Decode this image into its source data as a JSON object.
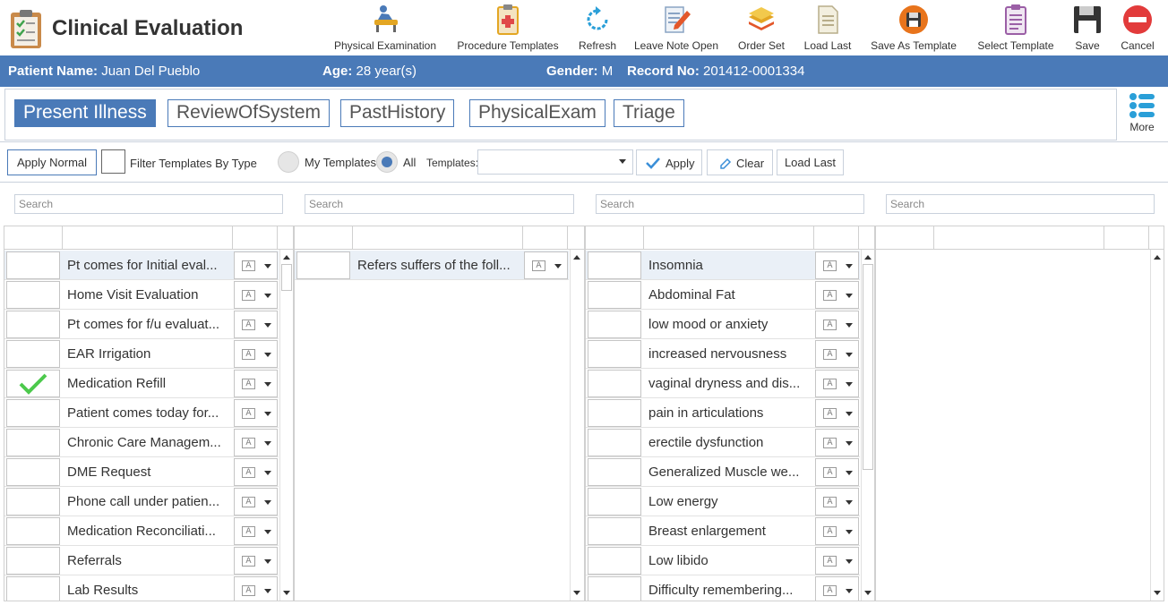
{
  "app": {
    "title": "Clinical Evaluation"
  },
  "toolbar": [
    {
      "name": "physical-examination-button",
      "icon": "physical-exam-icon",
      "label": "Physical Examination"
    },
    {
      "name": "procedure-templates-button",
      "icon": "procedure-templates-icon",
      "label": "Procedure Templates"
    },
    {
      "name": "refresh-button",
      "icon": "refresh-icon",
      "label": "Refresh"
    },
    {
      "name": "leave-note-open-button",
      "icon": "leave-note-open-icon",
      "label": "Leave Note Open"
    },
    {
      "name": "order-set-button",
      "icon": "order-set-icon",
      "label": "Order Set"
    },
    {
      "name": "load-last-toolbar-button",
      "icon": "load-last-icon",
      "label": "Load Last"
    },
    {
      "name": "save-as-template-button",
      "icon": "save-as-template-icon",
      "label": "Save As Template"
    },
    {
      "name": "select-template-button",
      "icon": "select-template-icon",
      "label": "Select Template"
    },
    {
      "name": "save-button",
      "icon": "save-icon",
      "label": "Save"
    },
    {
      "name": "cancel-button",
      "icon": "cancel-icon",
      "label": "Cancel"
    }
  ],
  "patient": {
    "name_label": "Patient Name:",
    "name": "Juan Del Pueblo",
    "age_label": "Age:",
    "age": "28 year(s)",
    "gender_label": "Gender:",
    "gender": "M",
    "record_label": "Record No:",
    "record": "201412-0001334"
  },
  "tabs": [
    {
      "label": "Present Illness",
      "active": true
    },
    {
      "label": "ReviewOfSystem",
      "active": false
    },
    {
      "label": "PastHistory",
      "active": false
    },
    {
      "label": "PhysicalExam",
      "active": false
    },
    {
      "label": "Triage",
      "active": false
    }
  ],
  "more": {
    "label": "More"
  },
  "filters": {
    "apply_normal": "Apply Normal",
    "filter_by_type": "Filter Templates By Type",
    "my_templates": "My Templates",
    "all": "All",
    "all_selected": true,
    "templates_label": "Templates:",
    "templates_value": "",
    "apply": "Apply",
    "clear": "Clear",
    "load_last": "Load Last"
  },
  "search_placeholder": "Search",
  "grid1": {
    "rows": [
      {
        "text": "Pt comes for Initial eval...",
        "checked": false,
        "selected": true
      },
      {
        "text": "Home Visit Evaluation",
        "checked": false
      },
      {
        "text": "Pt comes for f/u evaluat...",
        "checked": false
      },
      {
        "text": "EAR Irrigation",
        "checked": false
      },
      {
        "text": "Medication Refill",
        "checked": true
      },
      {
        "text": "Patient comes today for...",
        "checked": false
      },
      {
        "text": "Chronic Care Managem...",
        "checked": false
      },
      {
        "text": "DME Request",
        "checked": false
      },
      {
        "text": "Phone call under patien...",
        "checked": false
      },
      {
        "text": "Medication Reconciliati...",
        "checked": false
      },
      {
        "text": "Referrals",
        "checked": false
      },
      {
        "text": "Lab Results",
        "checked": false
      }
    ]
  },
  "grid2": {
    "rows": [
      {
        "text": "Refers suffers of the foll...",
        "checked": false,
        "selected": true
      }
    ]
  },
  "grid3": {
    "rows": [
      {
        "text": "Insomnia",
        "checked": false,
        "selected": true
      },
      {
        "text": "Abdominal Fat",
        "checked": false
      },
      {
        "text": "low mood or anxiety",
        "checked": false
      },
      {
        "text": "increased nervousness",
        "checked": false
      },
      {
        "text": "vaginal dryness and dis...",
        "checked": false
      },
      {
        "text": "pain in articulations",
        "checked": false
      },
      {
        "text": "erectile dysfunction",
        "checked": false
      },
      {
        "text": "Generalized Muscle we...",
        "checked": false
      },
      {
        "text": "Low energy",
        "checked": false
      },
      {
        "text": "Breast enlargement",
        "checked": false
      },
      {
        "text": "Low libido",
        "checked": false
      },
      {
        "text": "Difficulty remembering...",
        "checked": false
      }
    ]
  },
  "colors": {
    "accent": "#4a7ab8",
    "check": "#4cc94c",
    "row_selected": "#eaf0f7"
  }
}
